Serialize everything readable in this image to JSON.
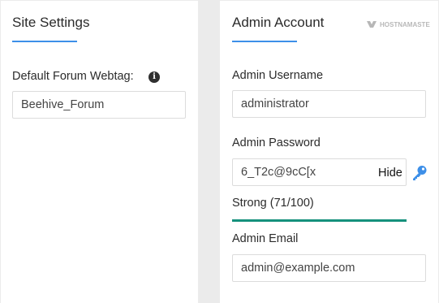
{
  "site_settings": {
    "title": "Site Settings",
    "forum_webtag": {
      "label": "Default Forum Webtag:",
      "value": "Beehive_Forum",
      "info_icon": "info-icon"
    }
  },
  "admin_account": {
    "title": "Admin Account",
    "username": {
      "label": "Admin Username",
      "value": "administrator"
    },
    "password": {
      "label": "Admin Password",
      "value": "6_T2c@9cC[x",
      "toggle_label": "Hide",
      "key_icon": "key-icon",
      "strength_text": "Strong (71/100)",
      "strength_score": 71,
      "strength_color": "#15917c"
    },
    "email": {
      "label": "Admin Email",
      "value": "admin@example.com"
    }
  },
  "watermark": {
    "text": "HOSTNAMASTE"
  },
  "colors": {
    "accent": "#3d8fe8",
    "strength": "#15917c",
    "background": "#ebebeb",
    "panel": "#ffffff"
  }
}
